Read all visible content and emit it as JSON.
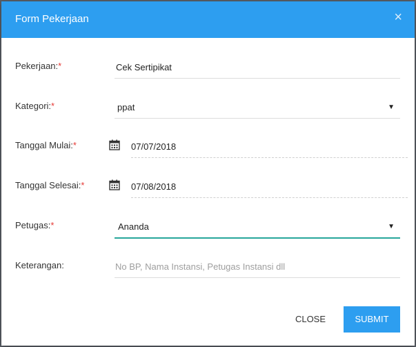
{
  "modal": {
    "title": "Form Pekerjaan",
    "close_icon": "×"
  },
  "form": {
    "required_marker": "*",
    "pekerjaan": {
      "label": "Pekerjaan:",
      "value": "Cek Sertipikat"
    },
    "kategori": {
      "label": "Kategori:",
      "value": "ppat",
      "caret": "▼"
    },
    "tanggal_mulai": {
      "label": "Tanggal Mulai:",
      "value": "07/07/2018",
      "icon": "calendar-icon"
    },
    "tanggal_selesai": {
      "label": "Tanggal Selesai:",
      "value": "07/08/2018",
      "icon": "calendar-icon"
    },
    "petugas": {
      "label": "Petugas:",
      "value": "Ananda",
      "caret": "▼"
    },
    "keterangan": {
      "label": "Keterangan:",
      "placeholder": "No BP, Nama Instansi, Petugas Instansi dll"
    }
  },
  "buttons": {
    "close_label": "CLOSE",
    "submit_label": "SUBMIT"
  },
  "colors": {
    "header": "#2d9ef0",
    "required": "#e53935",
    "active_underline": "#26a69a"
  }
}
